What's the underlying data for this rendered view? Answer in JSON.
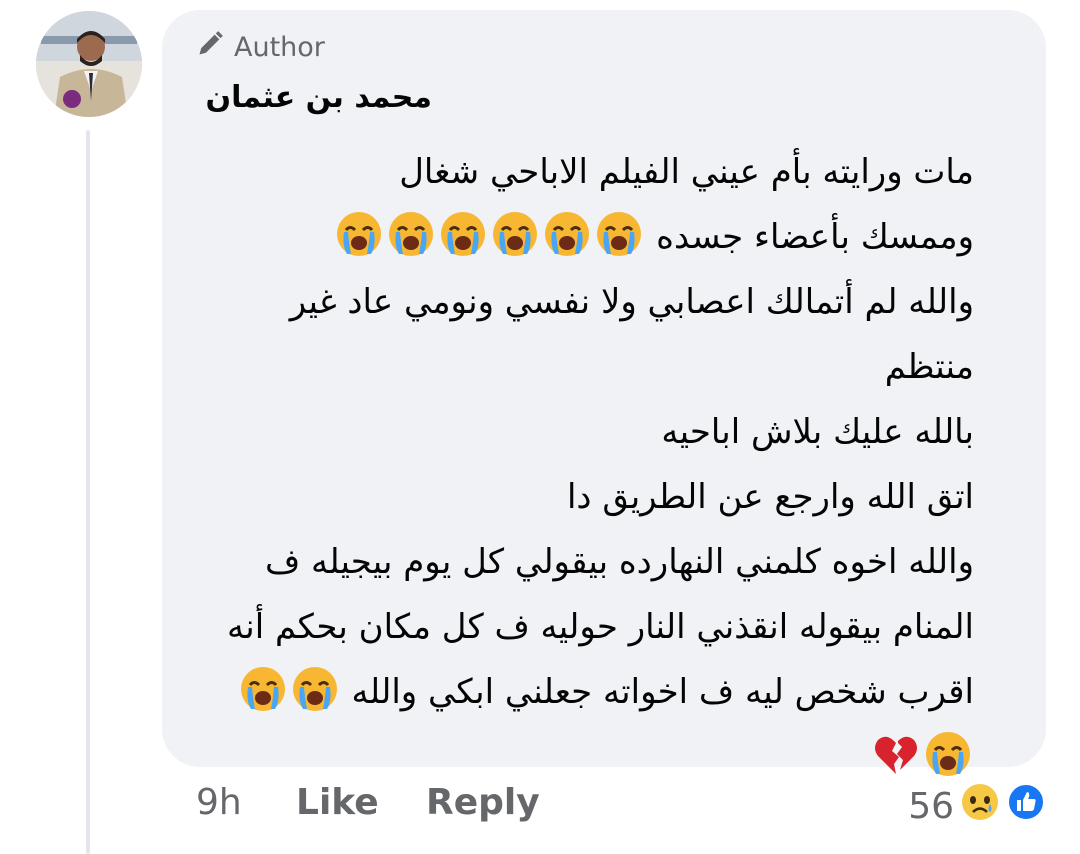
{
  "comment": {
    "author_badge": "Author",
    "author_name": "محمد بن عثمان",
    "lines": [
      "مات ورايته بأم عيني الفيلم الاباحي شغال",
      "وممسك بأعضاء جسده",
      "والله لم أتمالك اعصابي ولا نفسي ونومي عاد غير",
      "منتظم",
      "بالله عليك بلاش اباحيه",
      "اتق الله وارجع عن الطريق دا",
      "والله اخوه كلمني النهارده بيقولي كل يوم بيجيله ف",
      "المنام بيقوله انقذني النار حوليه ف كل مكان بحكم أنه",
      "اقرب شخص ليه ف اخواته جعلني ابكي والله"
    ],
    "line_emojis": {
      "1": [
        "crying-face",
        "crying-face",
        "crying-face",
        "crying-face",
        "crying-face",
        "crying-face"
      ],
      "8": [
        "crying-face",
        "crying-face"
      ],
      "9": [
        "crying-face",
        "broken-heart"
      ]
    },
    "actions": {
      "time": "9h",
      "like": "Like",
      "reply": "Reply"
    },
    "reactions": {
      "count": "56",
      "icons": [
        "sad-face-reaction",
        "like-reaction"
      ]
    },
    "colors": {
      "bubble": "#f0f2f5",
      "secondary_text": "#65676b",
      "primary_text": "#050505",
      "like_blue": "#1877f2"
    }
  }
}
